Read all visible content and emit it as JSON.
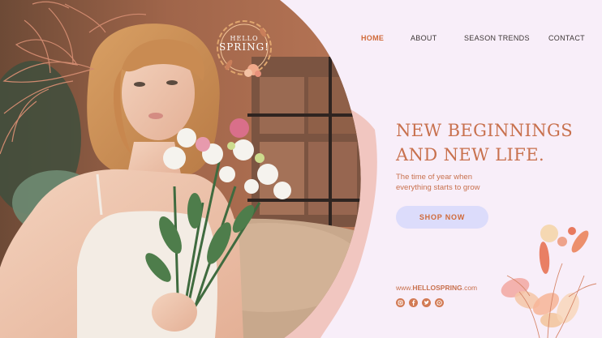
{
  "brand": {
    "logo_line1": "HELLO",
    "logo_line2": "SPRING!"
  },
  "nav": {
    "items": [
      {
        "label": "HOME",
        "active": true
      },
      {
        "label": "ABOUT",
        "active": false
      },
      {
        "label": "SEASON TRENDS",
        "active": false
      },
      {
        "label": "CONTACT",
        "active": false
      }
    ]
  },
  "hero": {
    "title_line1": "NEW BEGINNINGS",
    "title_line2": "AND NEW LIFE.",
    "subtitle_line1": "The time of year when",
    "subtitle_line2": "everything starts to grow",
    "cta_label": "SHOP NOW"
  },
  "footer": {
    "site_prefix": "www.",
    "site_name": "HELLOSPRING",
    "site_suffix": ".com",
    "social_icons": [
      "instagram-icon",
      "facebook-icon",
      "twitter-icon",
      "whatsapp-icon"
    ]
  },
  "colors": {
    "background": "#f8eef9",
    "accent": "#c8714e",
    "button_bg": "#dcdcfb",
    "nav_active": "#d06a3a",
    "nav_text": "#3d3636"
  }
}
